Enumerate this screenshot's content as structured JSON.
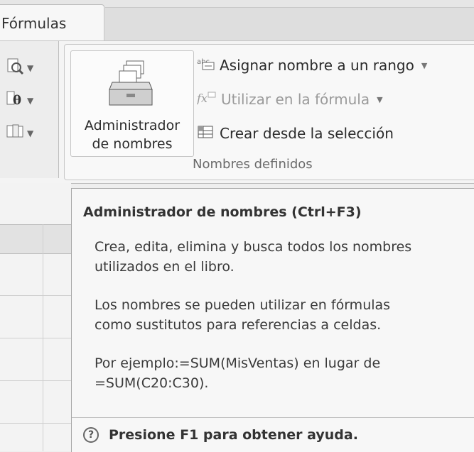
{
  "tabs": {
    "active_label": "Fórmulas"
  },
  "names_group": {
    "big_button": {
      "line1": "Administrador",
      "line2": "de nombres"
    },
    "define_name": {
      "label": "Asignar nombre a un rango"
    },
    "use_in_formula": {
      "label": "Utilizar en la fórmula"
    },
    "create_from_selection": {
      "label": "Crear desde la selección"
    },
    "title": "Nombres definidos"
  },
  "tooltip": {
    "title": "Administrador de nombres (Ctrl+F3)",
    "p1_line1": "Crea, edita, elimina y busca todos los nombres",
    "p1_line2": "utilizados en el libro.",
    "p2_line1": "Los nombres se pueden utilizar en fórmulas",
    "p2_line2": "como sustitutos para referencias a celdas.",
    "p3_line1": "Por ejemplo:=SUM(MisVentas) en lugar de",
    "p3_line2": "=SUM(C20:C30).",
    "help": "Presione F1 para obtener ayuda."
  }
}
